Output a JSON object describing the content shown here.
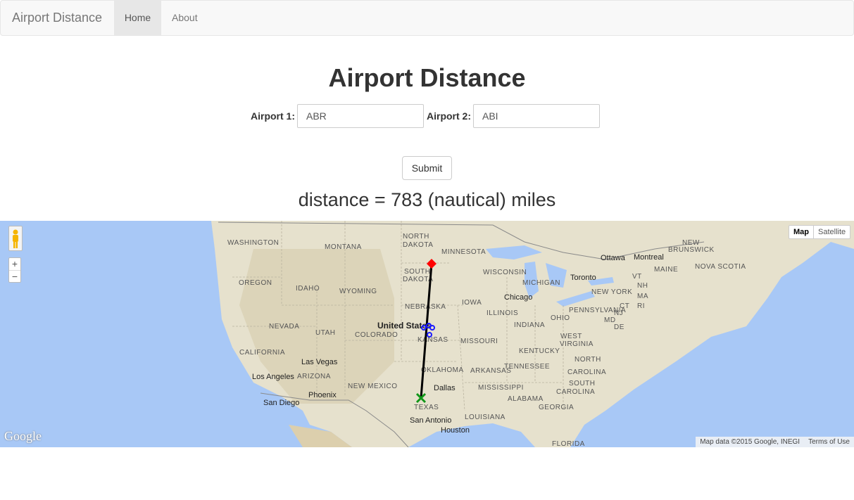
{
  "navbar": {
    "brand": "Airport Distance",
    "items": [
      "Home",
      "About"
    ]
  },
  "heading": "Airport Distance",
  "form": {
    "airport1_label": "Airport 1:",
    "airport1_value": "ABR",
    "airport2_label": "Airport 2:",
    "airport2_value": "ABI",
    "submit_label": "Submit"
  },
  "result": "distance = 783 (nautical) miles",
  "map": {
    "type_buttons": [
      "Map",
      "Satellite"
    ],
    "zoom": [
      "+",
      "−"
    ],
    "logo": "Google",
    "attribution": [
      "Map data ©2015 Google, INEGI",
      "Terms of Use"
    ],
    "region_labels": [
      "WASHINGTON",
      "MONTANA",
      "NORTH DAKOTA",
      "MINNESOTA",
      "SOUTH DAKOTA",
      "WISCONSIN",
      "MICHIGAN",
      "OREGON",
      "IDAHO",
      "WYOMING",
      "NEBRASKA",
      "IOWA",
      "ILLINOIS",
      "INDIANA",
      "OHIO",
      "NEVADA",
      "UTAH",
      "COLORADO",
      "KANSAS",
      "MISSOURI",
      "KENTUCKY",
      "CALIFORNIA",
      "OKLAHOMA",
      "TENNESSEE",
      "ARIZONA",
      "NEW MEXICO",
      "ARKANSAS",
      "MISSISSIPPI",
      "ALABAMA",
      "GEORGIA",
      "TEXAS",
      "LOUISIANA",
      "FLORIDA",
      "PENNSYLVANIA",
      "NEW YORK",
      "WEST VIRGINIA",
      "VIRGINIA",
      "NORTH CAROLINA",
      "SOUTH CAROLINA",
      "MAINE",
      "NEW BRUNSWICK",
      "NOVA SCOTIA",
      "VT",
      "NH",
      "MA",
      "CT",
      "RI",
      "MD",
      "DE",
      "NJ"
    ],
    "city_labels": [
      "Ottawa",
      "Montreal",
      "Toronto",
      "Chicago",
      "Las Vegas",
      "Los Angeles",
      "San Diego",
      "Phoenix",
      "Dallas",
      "San Antonio",
      "Houston"
    ],
    "country_label": "United States",
    "colors": {
      "water": "#a8c8f6",
      "land": "#e8e4d4",
      "route": "#000000",
      "origin_marker": "#ff0000",
      "dest_marker": "#109618"
    }
  }
}
